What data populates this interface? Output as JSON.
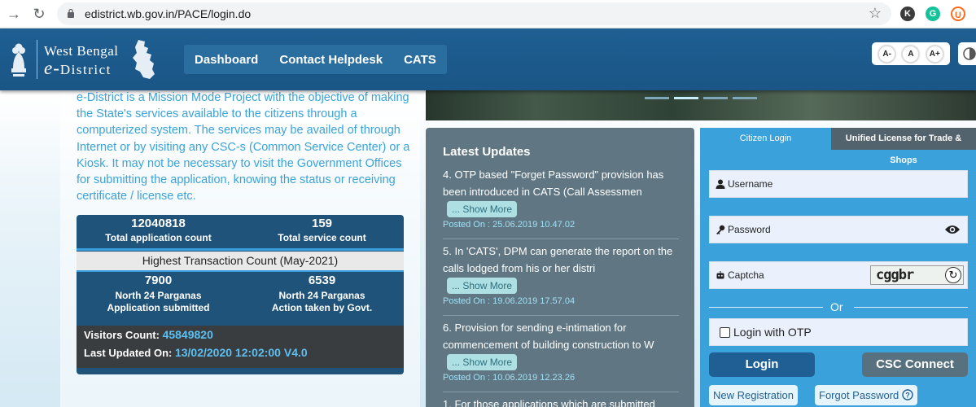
{
  "browser": {
    "url": "edistrict.wb.gov.in/PACE/login.do",
    "extensions": [
      {
        "icon": "k-avatar-icon",
        "label": "K",
        "color": "#3c3c3c"
      },
      {
        "icon": "grammarly-icon",
        "label": "G",
        "color": "#15c39a"
      },
      {
        "icon": "u-extension-icon",
        "label": "U",
        "color": "#ff6b1a"
      }
    ]
  },
  "header": {
    "logo_line1": "West Bengal",
    "logo_line2_e": "e-",
    "logo_line2_rest": "District",
    "nav": [
      "Dashboard",
      "Contact Helpdesk",
      "CATS"
    ],
    "font_controls": [
      "A-",
      "A",
      "A+"
    ]
  },
  "intro_text": "e-District is a Mission Mode Project with the objective of making the State's services available to the citizens through a computerized system. The services may be availed of through Internet or by visiting any CSC-s (Common Service Center) or a Kiosk. It may not be necessary to visit the Government Offices for submitting the application, knowing the status or receiving certificate / license etc.",
  "stats": {
    "total_applications": {
      "value": "12040818",
      "label": "Total application count"
    },
    "total_services": {
      "value": "159",
      "label": "Total service count"
    },
    "highest_title": "Highest Transaction Count (May-2021)",
    "app_submitted": {
      "value": "7900",
      "label1": "North 24 Parganas",
      "label2": "Application submitted"
    },
    "action_taken": {
      "value": "6539",
      "label1": "North 24 Parganas",
      "label2": "Action taken by Govt."
    },
    "visitors_label": "Visitors Count:",
    "visitors_value": "45849820",
    "updated_label": "Last Updated On:",
    "updated_value": "13/02/2020 12:02:00 V4.0"
  },
  "updates": {
    "title": "Latest Updates",
    "show_more_label": "... Show More",
    "items": [
      {
        "text": "4. OTP based \"Forget Password\" provision has been introduced in CATS (Call Assessmen",
        "posted": "Posted On : 25.06.2019 10.47.02"
      },
      {
        "text": "5. In 'CATS', DPM can generate the report on the calls lodged from his or her distri",
        "posted": "Posted On : 19.06.2019 17.57.04"
      },
      {
        "text": "6. Provision for sending e-intimation for commencement of building construction to W",
        "posted": "Posted On : 10.06.2019 12.23.26"
      },
      {
        "text": "1. For those applications which are submitted"
      }
    ]
  },
  "login": {
    "tab_citizen": "Citizen Login",
    "tab_license": "Unified License for Trade & Shops",
    "username_label": "Username",
    "password_label": "Password",
    "captcha_label": "Captcha",
    "captcha_text": "cggbr",
    "or_text": "Or",
    "otp_label": "Login with OTP",
    "login_button": "Login",
    "csc_button": "CSC Connect",
    "new_registration": "New Registration",
    "forgot_password": "Forgot Password"
  }
}
